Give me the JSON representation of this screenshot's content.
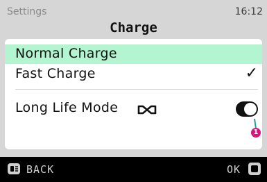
{
  "status_bar": {
    "app_name": "Settings",
    "time": "16:12"
  },
  "screen": {
    "title": "Charge"
  },
  "menu": {
    "items": [
      {
        "label": "Normal Charge",
        "selected": true
      },
      {
        "label": "Fast Charge",
        "checked": true,
        "check_glyph": "✓"
      },
      {
        "label": "Long Life Mode",
        "icon": "infinity-battery-icon",
        "toggle_on": true
      }
    ]
  },
  "annotation": {
    "label": "1",
    "color": "#d6167d"
  },
  "softkeys": {
    "back_label": "BACK",
    "back_icon": "back-button-icon",
    "ok_label": "OK",
    "ok_icon": "ok-button-icon"
  },
  "colors": {
    "highlight": "#b3f5d1",
    "annotation_line": "#1aa39a"
  }
}
